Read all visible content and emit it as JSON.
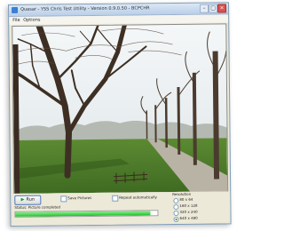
{
  "window": {
    "title": "Quasar - YSS Chris Test Utility - Version 0.9.0.50 - BCPCHR"
  },
  "menu": {
    "items": [
      "File",
      "Options"
    ]
  },
  "controls": {
    "run_label": "Run",
    "save_pictures_label": "Save Pictures",
    "repeat_label": "Repeat automatically",
    "status_text": "Status:   Picture completed",
    "progress": 0.95
  },
  "resolution": {
    "title": "Resolution",
    "options": [
      "80 x 64",
      "160 x 128",
      "320 x 240",
      "640 x 480"
    ],
    "selected_index": 3
  },
  "colors": {
    "accent": "#4a78c2",
    "progress": "#1fbf2a",
    "window_bg": "#ece9d8"
  }
}
